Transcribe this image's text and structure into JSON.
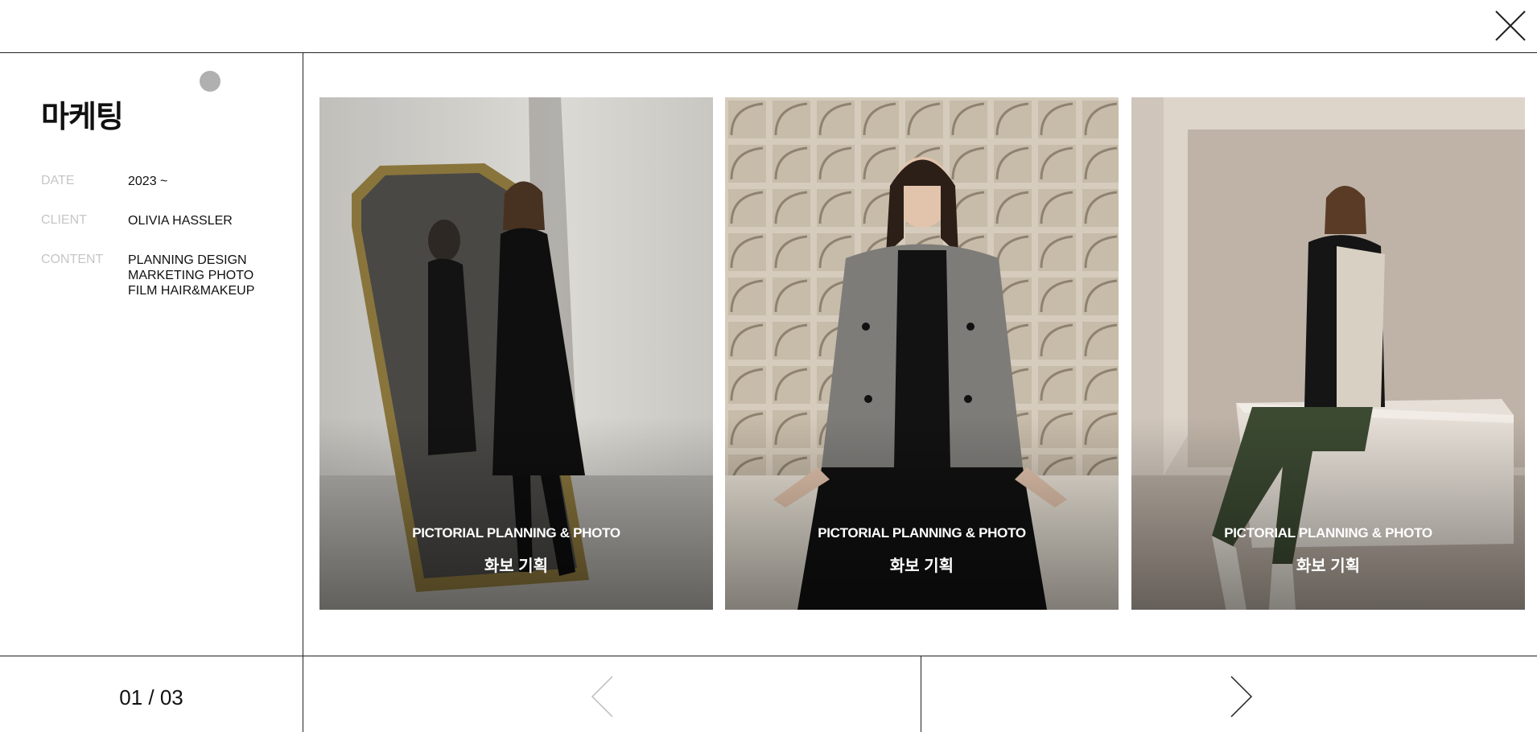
{
  "header": {
    "close_icon": "close-icon"
  },
  "sidebar": {
    "title": "마케팅",
    "meta": {
      "date_label": "DATE",
      "date_value": "2023 ~",
      "client_label": "CLIENT",
      "client_value": "OLIVIA HASSLER",
      "content_label": "CONTENT",
      "content_lines": [
        "PLANNING DESIGN",
        "MARKETING PHOTO",
        "FILM HAIR&MAKEUP"
      ]
    }
  },
  "gallery": {
    "items": [
      {
        "subtitle": "PICTORIAL PLANNING & PHOTO",
        "title": "화보 기획"
      },
      {
        "subtitle": "PICTORIAL PLANNING & PHOTO",
        "title": "화보 기획"
      },
      {
        "subtitle": "PICTORIAL PLANNING & PHOTO",
        "title": "화보 기획"
      }
    ]
  },
  "pagination": {
    "counter": "01 / 03",
    "prev_icon": "chevron-left-icon",
    "next_icon": "chevron-right-icon"
  },
  "colors": {
    "line": "#222222",
    "label": "#c6c6c6",
    "dot": "#b0b0b0",
    "text": "#111111"
  }
}
